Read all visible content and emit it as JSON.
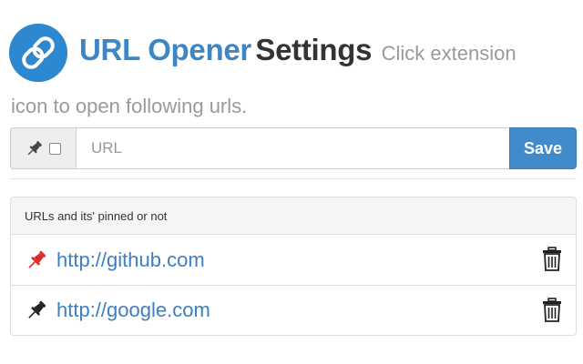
{
  "header": {
    "logo_icon": "link-logo-icon",
    "title_brand": "URL Opener",
    "title_rest": "Settings",
    "subtitle_line1": "Click extension",
    "subtitle_line2": "icon to open following urls."
  },
  "form": {
    "pin_icon": "pin-icon",
    "pin_checked": false,
    "url_value": "",
    "url_placeholder": "URL",
    "save_label": "Save"
  },
  "panel": {
    "heading": "URLs and its' pinned or not",
    "items": [
      {
        "url": "http://github.com",
        "pinned": true,
        "pin_color": "#e02a2a"
      },
      {
        "url": "http://google.com",
        "pinned": false,
        "pin_color": "#222222"
      }
    ]
  },
  "colors": {
    "brand": "#3d86c6",
    "save_button": "#428bca",
    "link": "#3d7fc1"
  }
}
